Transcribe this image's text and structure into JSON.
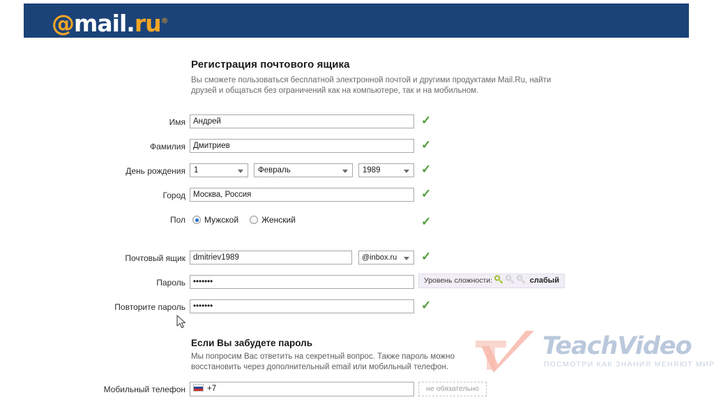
{
  "header": {
    "logo": {
      "at": "@",
      "mail": "mail",
      "dot": ".",
      "ru": "ru",
      "registered": "®"
    },
    "bar_color": "#1c4378",
    "accent_color": "#f5a623"
  },
  "page": {
    "title": "Регистрация почтового ящика",
    "subtitle": "Вы сможете пользоваться бесплатной электронной почтой и другими продуктами Mail.Ru, найти друзей и общаться без ограничений как на компьютере, так и на мобильном."
  },
  "form": {
    "first_name": {
      "label": "Имя",
      "value": "Андрей",
      "placeholder": "",
      "valid": true
    },
    "last_name": {
      "label": "Фамилия",
      "value": "Дмитриев",
      "placeholder": "",
      "valid": true
    },
    "birthday": {
      "label": "День рождения",
      "day": "1",
      "month": "Февраль",
      "year": "1989",
      "valid": true
    },
    "city": {
      "label": "Город",
      "value": "Москва, Россия",
      "placeholder": "",
      "valid": true
    },
    "gender": {
      "label": "Пол",
      "male": "Мужской",
      "female": "Женский",
      "selected": "male",
      "valid": true
    },
    "mailbox": {
      "label": "Почтовый ящик",
      "value": "dmitriev1989",
      "placeholder": "",
      "domain": "@inbox.ru",
      "valid": true
    },
    "password": {
      "label": "Пароль",
      "value": "•••••••",
      "placeholder": ""
    },
    "password_repeat": {
      "label": "Повторите пароль",
      "value": "•••••••",
      "placeholder": "",
      "valid": true
    },
    "strength": {
      "caption": "Уровень сложности:",
      "level": "слабый",
      "filled_keys": 1,
      "total_keys": 3,
      "key_on_color": "#b4d44a",
      "key_off_color": "#d4d4d4"
    },
    "phone": {
      "label": "Мобильный телефон",
      "country_code": "+7",
      "placeholder": "",
      "optional_hint": "не обязательно",
      "flag": "ru-flag-icon"
    }
  },
  "forgot": {
    "title": "Если Вы забудете пароль",
    "text": "Мы попросим Вас ответить на секретный вопрос. Также пароль можно восстановить через дополнительный email или мобильный телефон."
  },
  "watermark": {
    "title": "TeachVideo",
    "subtitle": "ПОСМОТРИ КАК ЗНАНИЯ МЕНЯЮТ МИР"
  },
  "icons": {
    "check": "✓"
  }
}
